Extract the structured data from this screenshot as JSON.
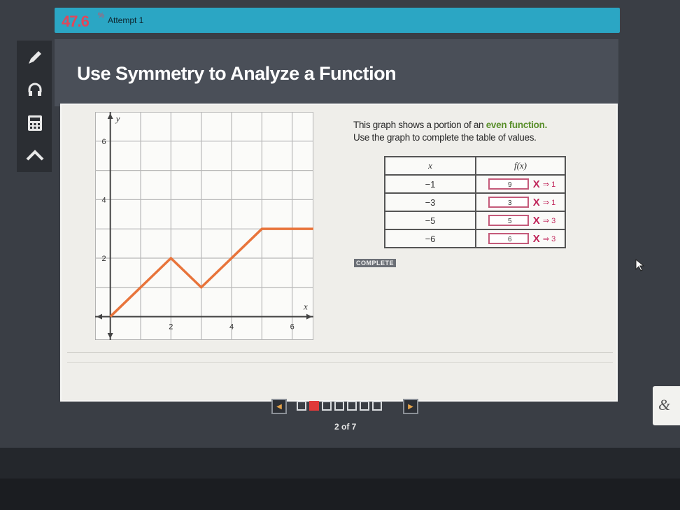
{
  "topbar": {
    "score": "47.6",
    "score_sup": "%",
    "attempt": "Attempt 1"
  },
  "toolbar": {
    "tools": [
      "pencil-icon",
      "headphones-icon",
      "calculator-icon",
      "arrow-up-icon"
    ]
  },
  "header": {
    "title": "Use Symmetry to Analyze a Function"
  },
  "instruction": {
    "line1_pre": "This graph shows a portion of an ",
    "line1_em": "even function.",
    "line2": "Use the graph to complete the table of values."
  },
  "table": {
    "col_x": "x",
    "col_fx": "f(x)",
    "rows": [
      {
        "x": "−1",
        "answer": "9",
        "mark": "X",
        "hint": "⇒ 1"
      },
      {
        "x": "−3",
        "answer": "3",
        "mark": "X",
        "hint": "⇒ 1"
      },
      {
        "x": "−5",
        "answer": "5",
        "mark": "X",
        "hint": "⇒ 3"
      },
      {
        "x": "−6",
        "answer": "6",
        "mark": "X",
        "hint": "⇒ 3"
      }
    ]
  },
  "complete_label": "COMPLETE",
  "pager": {
    "current": 2,
    "total": 7,
    "count_text": "2 of 7"
  },
  "side_card": {
    "label": "&"
  },
  "colors": {
    "accent": "#2ba6c4",
    "line": "#e8743b",
    "wrong": "#c0265a",
    "active_page": "#e03a3a"
  },
  "chart_data": {
    "type": "line",
    "xlabel": "x",
    "ylabel": "y",
    "x_ticks": [
      2,
      4,
      6
    ],
    "y_ticks": [
      2,
      4,
      6
    ],
    "xlim": [
      -0.5,
      6.7
    ],
    "ylim": [
      -0.8,
      7
    ],
    "series": [
      {
        "x": [
          0,
          2,
          3,
          5,
          6.7
        ],
        "y": [
          0,
          2,
          1,
          3,
          3
        ]
      }
    ]
  }
}
